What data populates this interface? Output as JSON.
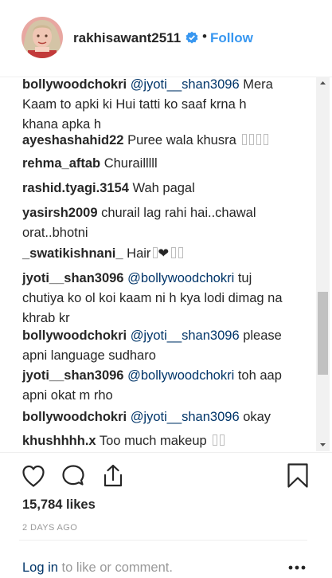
{
  "header": {
    "username": "rakhisawant2511",
    "separator": "•",
    "follow_label": "Follow"
  },
  "comments": [
    {
      "user": "bollywoodchokri",
      "mention": "@jyoti__shan3096",
      "text": " Mera Kaam to apki ki Hui tatti ko saaf krna h khana apka h"
    },
    {
      "user": "ayeshashahid22",
      "mention": "",
      "text": " Puree wala khusra"
    },
    {
      "user": "rehma_aftab",
      "mention": "",
      "text": " Churailllll"
    },
    {
      "user": "rashid.tyagi.3154",
      "mention": "",
      "text": " Wah pagal"
    },
    {
      "user": "yasirsh2009",
      "mention": "",
      "text": " churail lag rahi hai..chawal orat..bhotni"
    },
    {
      "user": "_swatikishnani_",
      "mention": "",
      "text": " Hair"
    },
    {
      "user": "jyoti__shan3096",
      "mention": "@bollywoodchokri",
      "text": " tuj chutiya ko ol koi kaam ni h kya lodi dimag na khrab kr"
    },
    {
      "user": "bollywoodchokri",
      "mention": "@jyoti__shan3096",
      "text": " please apni language sudharo"
    },
    {
      "user": "jyoti__shan3096",
      "mention": "@bollywoodchokri",
      "text": " toh aap apni okat m rho"
    },
    {
      "user": "bollywoodchokri",
      "mention": "@jyoti__shan3096",
      "text": " okay"
    },
    {
      "user": "khushhhh.x",
      "mention": "",
      "text": " Too much makeup"
    }
  ],
  "heart_glyph": "❤",
  "likes": "15,784 likes",
  "time": "2 DAYS AGO",
  "footer": {
    "login_label": "Log in",
    "rest": " to like or comment."
  },
  "icons": {
    "like": "heart-outline-icon",
    "comment": "speech-bubble-icon",
    "share": "share-upload-icon",
    "save": "bookmark-icon",
    "more": "more-options-icon",
    "verified": "verified-badge-icon"
  },
  "colors": {
    "link": "#003569",
    "follow": "#3897f0",
    "verified": "#3897f0",
    "muted": "#999999"
  }
}
